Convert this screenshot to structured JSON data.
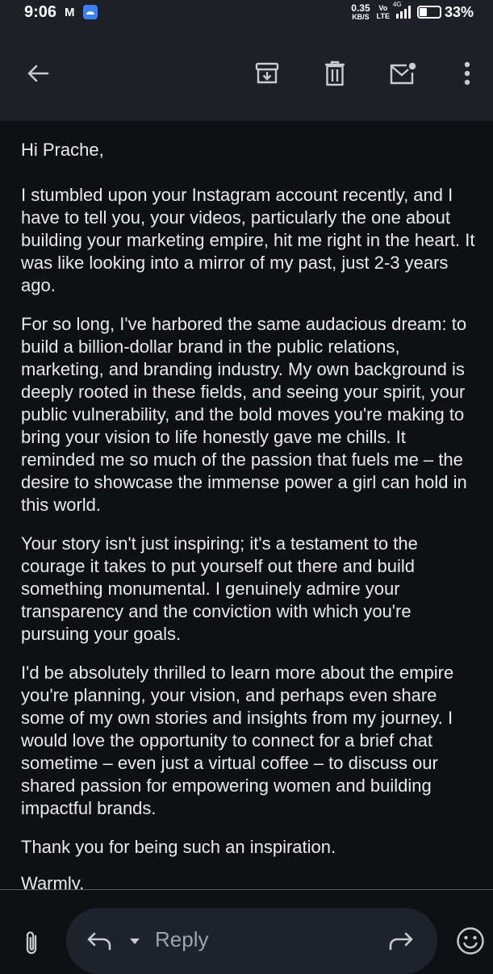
{
  "status_bar": {
    "time": "9:06",
    "gmail_glyph": "M",
    "net_speed_value": "0.35",
    "net_speed_unit": "KB/S",
    "volte_top": "Vo",
    "volte_bottom": "LTE",
    "network_type": "4G",
    "battery_percent": "33%",
    "battery_level": 0.33
  },
  "app_bar": {
    "icons": [
      "back-arrow-icon",
      "archive-icon",
      "delete-icon",
      "mark-unread-icon",
      "more-vert-icon"
    ]
  },
  "email": {
    "greeting": "Hi Prache,",
    "paragraphs": [
      "I stumbled upon your Instagram account recently, and I have to tell you, your videos, particularly the one about building your marketing empire, hit me right in the heart. It was like looking into a mirror of my past, just 2-3 years ago.",
      "For so long, I've harbored the same audacious dream: to build a billion-dollar brand in the public relations, marketing, and branding industry. My own background is deeply rooted in these fields, and seeing your spirit, your public vulnerability, and the bold moves you're making to bring your vision to life honestly gave me chills. It reminded me so much of the passion that fuels me – the desire to showcase the immense power a girl can hold in this world.",
      "Your story isn't just inspiring; it's a testament to the courage it takes to put yourself out there and build something monumental. I genuinely admire your transparency and the conviction with which you're pursuing your goals.",
      "I'd be absolutely thrilled to learn more about the empire you're planning, your vision, and perhaps even share some of my own stories and insights from my journey. I would love the opportunity to connect for a brief chat sometime – even just a virtual coffee – to discuss our shared passion for empowering women and building impactful brands.",
      "Thank you for being such an inspiration."
    ],
    "signoff": "Warmly,"
  },
  "bottom_bar": {
    "reply_label": "Reply",
    "icons": [
      "attachment-icon",
      "reply-icon",
      "reply-options-caret-icon",
      "forward-icon",
      "emoji-icon"
    ]
  },
  "colors": {
    "background": "#0f1014",
    "bar_background": "#1d2027",
    "pill_background": "#1e222b",
    "text": "#e9eaf0",
    "muted_text": "#9ea3ad"
  }
}
